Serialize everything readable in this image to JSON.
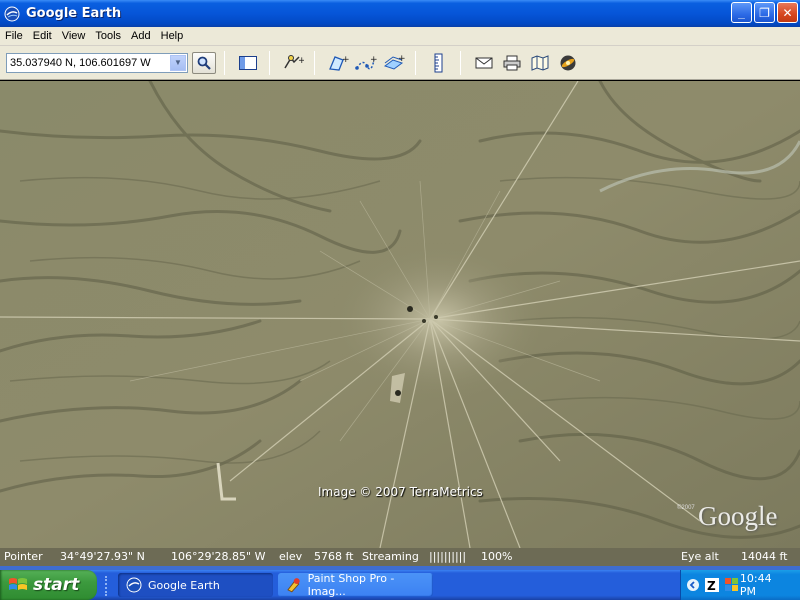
{
  "window": {
    "title": "Google Earth",
    "controls": {
      "minimize": "_",
      "maximize": "❐",
      "close": "✕"
    }
  },
  "menu": {
    "items": [
      "File",
      "Edit",
      "View",
      "Tools",
      "Add",
      "Help"
    ]
  },
  "toolbar": {
    "search_value": "35.037940 N, 106.601697 W",
    "buttons": [
      "search-icon",
      "sidebar-toggle-icon",
      "placemark-icon",
      "polygon-icon",
      "path-icon",
      "image-overlay-icon",
      "ruler-icon",
      "email-icon",
      "print-icon",
      "google-maps-icon",
      "sky-icon"
    ]
  },
  "map": {
    "copyright": "Image © 2007 TerraMetrics",
    "logo": "Google",
    "logo_small": "©2007"
  },
  "status": {
    "pointer_label": "Pointer",
    "lat": "34°49'27.93\" N",
    "lon": "106°29'28.85\" W",
    "elev_label": "elev",
    "elev_value": "5768 ft",
    "streaming_label": "Streaming",
    "streaming_bars": "||||||||||",
    "streaming_percent": "100%",
    "eye_alt_label": "Eye alt",
    "eye_alt_value": "14044 ft"
  },
  "taskbar": {
    "start_label": "start",
    "tasks": [
      {
        "label": "Google Earth",
        "active": true
      },
      {
        "label": "Paint Shop Pro - Imag...",
        "active": false
      }
    ],
    "clock": "10:44 PM"
  },
  "colors": {
    "titlebar": "#0655d8",
    "chrome": "#ece9d8",
    "statusbar": "#6d6b55",
    "taskbar": "#245edb",
    "start": "#3c9a3e",
    "terrain": "#8a8868"
  }
}
